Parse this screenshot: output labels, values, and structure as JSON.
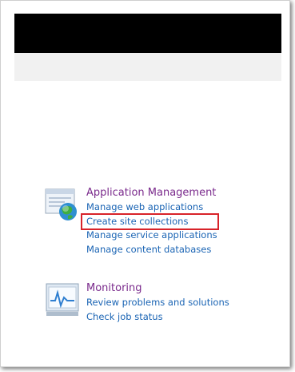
{
  "sections": [
    {
      "title": "Application Management",
      "icon": "application-management-icon",
      "links": [
        {
          "label": "Manage web applications"
        },
        {
          "label": "Create site collections",
          "highlighted": true
        },
        {
          "label": "Manage service applications"
        },
        {
          "label": "Manage content databases"
        }
      ]
    },
    {
      "title": "Monitoring",
      "icon": "monitoring-icon",
      "links": [
        {
          "label": "Review problems and solutions"
        },
        {
          "label": "Check job status"
        }
      ]
    }
  ],
  "colors": {
    "title": "#7a2a8c",
    "link": "#1a64b4",
    "highlight": "#d8232a",
    "header": "#000000",
    "subheader": "#f1f1f1"
  }
}
